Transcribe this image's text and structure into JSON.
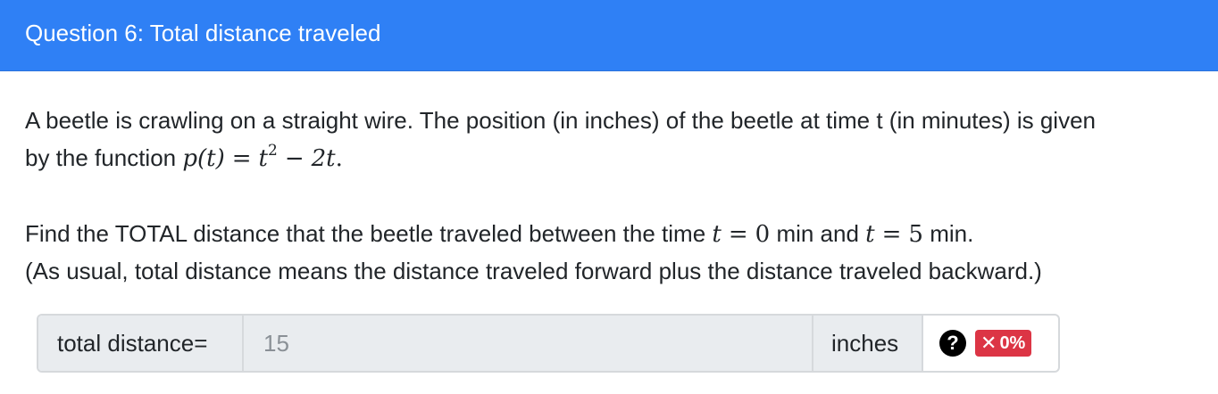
{
  "header": {
    "title": "Question 6: Total distance traveled"
  },
  "question": {
    "line1": "A beetle is crawling on a straight wire. The position (in inches) of the beetle at time t (in minutes) is given",
    "line2_prefix": "by the function",
    "function_lhs": "p(t)",
    "function_rhs_base": "t",
    "function_rhs_exp": "2",
    "function_rhs_tail": "2t",
    "line3_prefix": "Find the TOTAL distance that the beetle traveled between the time",
    "t_var": "t",
    "t_start": "0",
    "mid_text": "min and",
    "t_end": "5",
    "end_text": "min.",
    "line4": "(As usual, total distance means the distance traveled forward plus the distance traveled backward.)"
  },
  "answer": {
    "label": "total distance=",
    "value": "15",
    "unit": "inches",
    "help_icon_glyph": "?",
    "score_icon": "x-icon",
    "score_text": "0%",
    "score_color": "#dc3545"
  }
}
